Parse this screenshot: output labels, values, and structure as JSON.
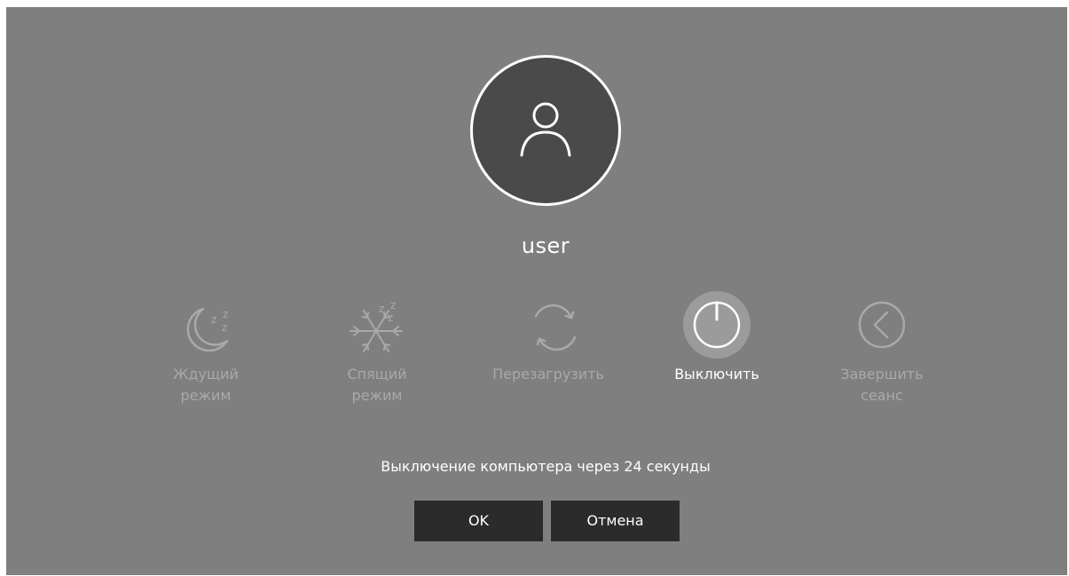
{
  "user": {
    "name": "user",
    "avatar_icon": "person-icon"
  },
  "options": [
    {
      "name": "standby",
      "icon": "moon-zzz-icon",
      "line1": "Ждущий",
      "line2": "режим",
      "selected": false
    },
    {
      "name": "hibernate",
      "icon": "snowflake-zzz-icon",
      "line1": "Спящий",
      "line2": "режим",
      "selected": false
    },
    {
      "name": "restart",
      "icon": "restart-arrows-icon",
      "line1": "Перезагрузить",
      "line2": "",
      "selected": false
    },
    {
      "name": "shutdown",
      "icon": "power-icon",
      "line1": "Выключить",
      "line2": "",
      "selected": true
    },
    {
      "name": "logoff",
      "icon": "chevron-left-circle-icon",
      "line1": "Завершить",
      "line2": "сеанс",
      "selected": false
    }
  ],
  "countdown": "Выключение компьютера через 24 секунды",
  "buttons": {
    "ok": "OK",
    "cancel": "Отмена"
  },
  "colors": {
    "background": "#7f7f7f",
    "avatar": "#4a4a4a",
    "button": "#2b2b2b",
    "inactive_text": "#a9a9a9",
    "active_text": "#ffffff"
  }
}
